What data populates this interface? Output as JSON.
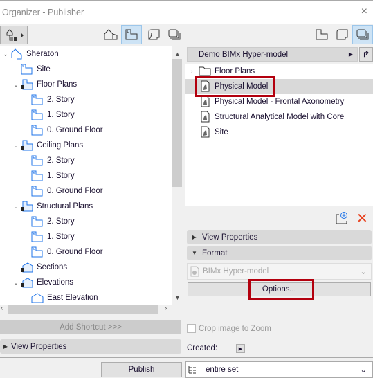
{
  "window": {
    "title": "Organizer - Publisher",
    "close": "×"
  },
  "left": {
    "tree": [
      {
        "label": "Sheraton",
        "level": 0,
        "expanded": true,
        "icon": "project-icon"
      },
      {
        "label": "Site",
        "level": 1,
        "icon": "story-icon"
      },
      {
        "label": "Floor Plans",
        "level": 1,
        "expanded": true,
        "icon": "folder-plan-icon"
      },
      {
        "label": "2. Story",
        "level": 2,
        "icon": "story-icon"
      },
      {
        "label": "1. Story",
        "level": 2,
        "icon": "story-icon"
      },
      {
        "label": "0. Ground Floor",
        "level": 2,
        "icon": "story-icon"
      },
      {
        "label": "Ceiling Plans",
        "level": 1,
        "expanded": true,
        "icon": "folder-plan-icon"
      },
      {
        "label": "2. Story",
        "level": 2,
        "icon": "story-icon"
      },
      {
        "label": "1. Story",
        "level": 2,
        "icon": "story-icon"
      },
      {
        "label": "0. Ground Floor",
        "level": 2,
        "icon": "story-icon"
      },
      {
        "label": "Structural Plans",
        "level": 1,
        "expanded": true,
        "icon": "folder-plan-icon"
      },
      {
        "label": "2. Story",
        "level": 2,
        "icon": "story-icon"
      },
      {
        "label": "1. Story",
        "level": 2,
        "icon": "story-icon"
      },
      {
        "label": "0. Ground Floor",
        "level": 2,
        "icon": "story-icon"
      },
      {
        "label": "Sections",
        "level": 1,
        "icon": "folder-section-icon"
      },
      {
        "label": "Elevations",
        "level": 1,
        "expanded": true,
        "icon": "folder-section-icon"
      },
      {
        "label": "East Elevation",
        "level": 2,
        "icon": "elevation-icon"
      }
    ],
    "add_shortcut": "Add Shortcut >>>",
    "view_properties": "View Properties",
    "publish": "Publish"
  },
  "right": {
    "set_name": "Demo BIMx Hyper-model",
    "items": [
      {
        "label": "Floor Plans",
        "icon": "folder-icon",
        "expandable": true
      },
      {
        "label": "Physical Model",
        "icon": "bimx-file-icon",
        "selected": true
      },
      {
        "label": "Physical Model - Frontal Axonometry",
        "icon": "bimx-file-icon"
      },
      {
        "label": "Structural Analytical Model with Core",
        "icon": "bimx-file-icon"
      },
      {
        "label": "Site",
        "icon": "bimx-file-icon"
      }
    ],
    "view_properties": "View Properties",
    "format": "Format",
    "format_value": "BIMx Hyper-model",
    "options": "Options...",
    "crop": "Crop image to Zoom",
    "created": "Created:",
    "publish_scope": "entire set"
  },
  "colors": {
    "highlight": "#b3000e",
    "accent": "#1e73e8",
    "selection": "#d9d9d9"
  }
}
